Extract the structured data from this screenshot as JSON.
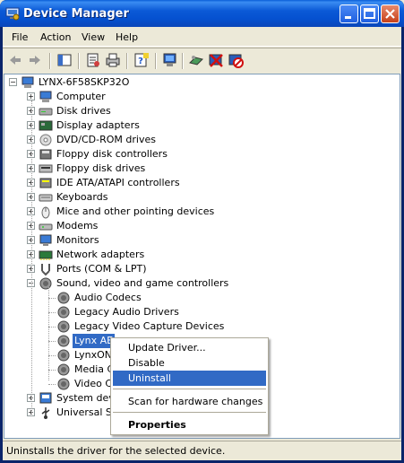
{
  "window": {
    "title": "Device Manager"
  },
  "menubar": [
    "File",
    "Action",
    "View",
    "Help"
  ],
  "tree": {
    "root": "LYNX-6F58SKP32O",
    "categories": [
      {
        "label": "Computer",
        "icon": "computer-icon"
      },
      {
        "label": "Disk drives",
        "icon": "disk-drive-icon"
      },
      {
        "label": "Display adapters",
        "icon": "display-adapter-icon"
      },
      {
        "label": "DVD/CD-ROM drives",
        "icon": "cdrom-icon"
      },
      {
        "label": "Floppy disk controllers",
        "icon": "floppy-controller-icon"
      },
      {
        "label": "Floppy disk drives",
        "icon": "floppy-drive-icon"
      },
      {
        "label": "IDE ATA/ATAPI controllers",
        "icon": "ide-controller-icon"
      },
      {
        "label": "Keyboards",
        "icon": "keyboard-icon"
      },
      {
        "label": "Mice and other pointing devices",
        "icon": "mouse-icon"
      },
      {
        "label": "Modems",
        "icon": "modem-icon"
      },
      {
        "label": "Monitors",
        "icon": "monitor-icon"
      },
      {
        "label": "Network adapters",
        "icon": "network-adapter-icon"
      },
      {
        "label": "Ports (COM & LPT)",
        "icon": "port-icon"
      },
      {
        "label": "Sound, video and game controllers",
        "icon": "speaker-icon"
      }
    ],
    "sound_children": [
      "Audio Codecs",
      "Legacy Audio Drivers",
      "Legacy Video Capture Devices",
      "Lynx AE",
      "LynxONE",
      "Media Co",
      "Video Co"
    ],
    "after": [
      {
        "label": "System devi",
        "icon": "system-device-icon"
      },
      {
        "label": "Universal Se",
        "icon": "usb-icon"
      }
    ]
  },
  "context_menu": {
    "items": [
      "Update Driver...",
      "Disable",
      "Uninstall",
      "Scan for hardware changes",
      "Properties"
    ]
  },
  "statusbar": {
    "text": "Uninstalls the driver for the selected device."
  },
  "colors": {
    "title_blue": "#0b59d6",
    "selection": "#316ac5",
    "face": "#ece9d8"
  }
}
